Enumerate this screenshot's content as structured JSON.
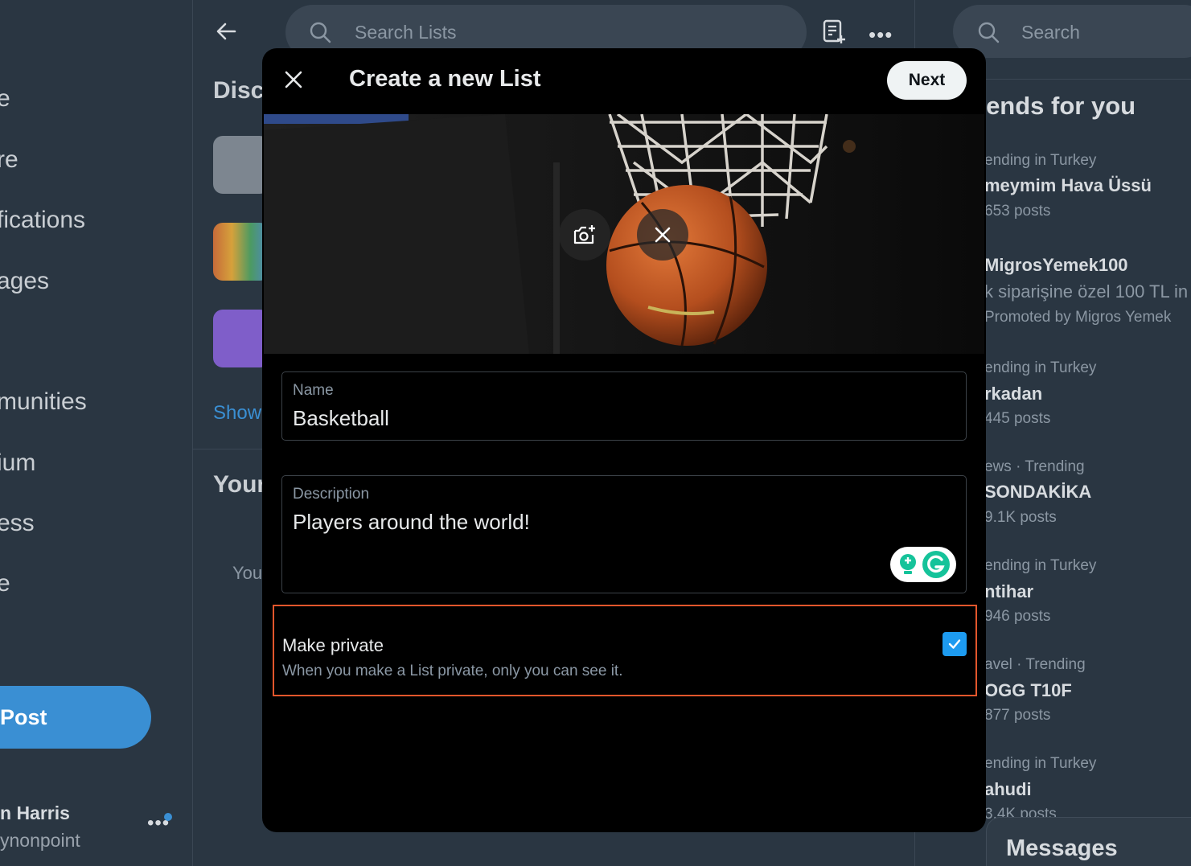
{
  "left_nav": {
    "items": [
      {
        "label": "e"
      },
      {
        "label": "re"
      },
      {
        "label": "fications"
      },
      {
        "label": "ages"
      },
      {
        "label": "munities"
      },
      {
        "label": "ium"
      },
      {
        "label": "ess"
      },
      {
        "label": "e"
      }
    ],
    "post_label": "Post",
    "account_name": "n Harris",
    "account_handle": "ynonpoint"
  },
  "center": {
    "search_placeholder": "Search Lists",
    "discover_heading": "Disc",
    "show_link": "Show",
    "your_heading": "Your",
    "your_text": "You"
  },
  "right": {
    "search_placeholder": "Search",
    "trends_title": "rends for you",
    "trends": [
      {
        "meta": "ending in Turkey",
        "name": "meymim Hava Üssü",
        "sub": "653 posts"
      },
      {
        "meta": "",
        "name": "MigrosYemek100",
        "sub": "k siparişine özel 100 TL in",
        "promo": "Promoted by Migros Yemek"
      },
      {
        "meta": "ending in Turkey",
        "name": "rkadan",
        "sub": "445 posts"
      },
      {
        "meta": "ews · Trending",
        "name": "SONDAKİKA",
        "sub": "9.1K posts"
      },
      {
        "meta": "ending in Turkey",
        "name": "ntihar",
        "sub": "946 posts"
      },
      {
        "meta": "avel · Trending",
        "name": "OGG T10F",
        "sub": "877 posts"
      },
      {
        "meta": "ending in Turkey",
        "name": "ahudi",
        "sub": "3.4K posts"
      }
    ],
    "messages_label": "Messages"
  },
  "modal": {
    "title": "Create a new List",
    "next_label": "Next",
    "name_label": "Name",
    "name_value": "Basketball",
    "description_label": "Description",
    "description_value": "Players around the world!",
    "private_title": "Make private",
    "private_desc": "When you make a List private, only you can see it.",
    "private_checked": true
  },
  "colors": {
    "accent": "#1d9bf0",
    "highlight_border": "#e2562c",
    "modal_bg": "#000000"
  }
}
